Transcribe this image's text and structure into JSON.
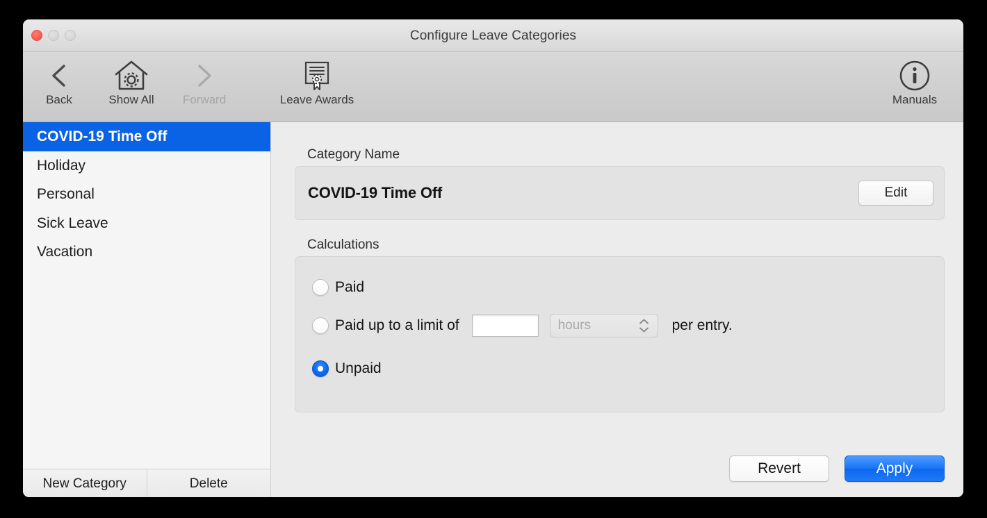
{
  "window": {
    "title": "Configure Leave Categories",
    "traffic_lights": {
      "close": "close-button",
      "minimize": "minimize-button",
      "zoom": "zoom-button"
    }
  },
  "toolbar": {
    "items": [
      {
        "label": "Back",
        "icon": "chevron-left-icon",
        "enabled": true
      },
      {
        "label": "Show All",
        "icon": "house-gear-icon",
        "enabled": true
      },
      {
        "label": "Forward",
        "icon": "chevron-right-icon",
        "enabled": false
      },
      {
        "label": "Leave Awards",
        "icon": "certificate-award-icon",
        "enabled": true
      },
      {
        "label": "Manuals",
        "icon": "info-circle-icon",
        "enabled": true
      }
    ]
  },
  "sidebar": {
    "categories": [
      {
        "label": "COVID-19 Time Off",
        "selected": true
      },
      {
        "label": "Holiday",
        "selected": false
      },
      {
        "label": "Personal",
        "selected": false
      },
      {
        "label": "Sick Leave",
        "selected": false
      },
      {
        "label": "Vacation",
        "selected": false
      }
    ],
    "footer": {
      "new_category_label": "New Category",
      "delete_label": "Delete"
    }
  },
  "main": {
    "category_name": {
      "section_label": "Category Name",
      "value": "COVID-19 Time Off",
      "edit_label": "Edit"
    },
    "calculations": {
      "section_label": "Calculations",
      "options": [
        {
          "label": "Paid",
          "selected": false
        },
        {
          "label": "Paid up to a limit of",
          "selected": false
        },
        {
          "label": "Unpaid",
          "selected": true
        }
      ],
      "limit_value": "",
      "limit_placeholder": "",
      "unit_value": "hours",
      "unit_enabled": false,
      "suffix_text": "per entry."
    },
    "footer": {
      "revert_label": "Revert",
      "apply_label": "Apply"
    }
  },
  "colors": {
    "selection_blue": "#0a62e4",
    "apply_blue": "#1673f5",
    "close_red": "#fb5d51",
    "window_bg": "#ececec",
    "sidebar_bg": "#f5f5f5",
    "panel_bg": "#e3e3e3"
  }
}
